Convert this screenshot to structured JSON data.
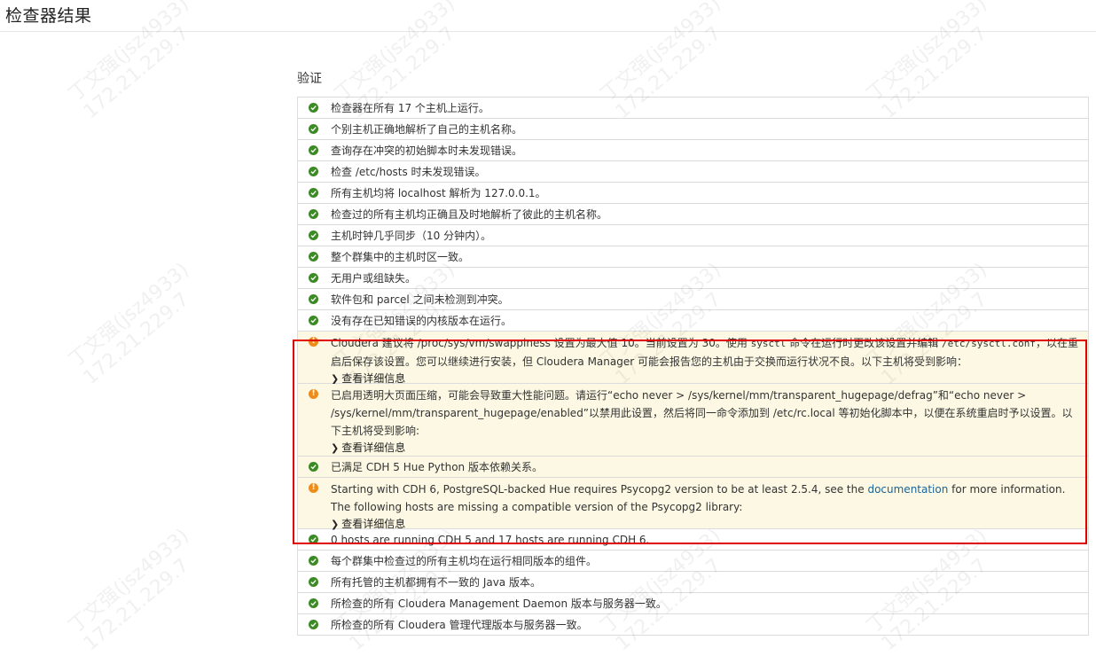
{
  "page": {
    "title": "检查器结果"
  },
  "section": {
    "title": "验证"
  },
  "details_label": "查看详细信息",
  "watermark": {
    "line1": "丁文强(jsz4933)",
    "line2": "172.21.229.7"
  },
  "rows": [
    {
      "status": "ok",
      "text": "检查器在所有 17 个主机上运行。"
    },
    {
      "status": "ok",
      "text": "个别主机正确地解析了自己的主机名称。"
    },
    {
      "status": "ok",
      "text": "查询存在冲突的初始脚本时未发现错误。"
    },
    {
      "status": "ok",
      "text": "检查 /etc/hosts 时未发现错误。"
    },
    {
      "status": "ok",
      "text": "所有主机均将 localhost 解析为 127.0.0.1。"
    },
    {
      "status": "ok",
      "text": "检查过的所有主机均正确且及时地解析了彼此的主机名称。"
    },
    {
      "status": "ok",
      "text": "主机时钟几乎同步（10 分钟内）。"
    },
    {
      "status": "ok",
      "text": "整个群集中的主机时区一致。"
    },
    {
      "status": "ok",
      "text": "无用户或组缺失。"
    },
    {
      "status": "ok",
      "text": "软件包和 parcel 之间未检测到冲突。"
    },
    {
      "status": "ok",
      "text": "没有存在已知错误的内核版本在运行。"
    },
    {
      "status": "warn",
      "text_a": "Cloudera 建议将 /proc/sys/vm/swappiness 设置为最大值 10。当前设置为 30。使用 ",
      "code_1": "sysctl",
      "text_b": " 命令在运行时更改该设置并编辑 ",
      "code_2": "/etc/sysctl.conf",
      "text_c": "，以在重启后保存该设置。您可以继续进行安装，但 Cloudera Manager 可能会报告您的主机由于交换而运行状况不良。以下主机将受到影响："
    },
    {
      "status": "warn",
      "text": "已启用透明大页面压缩，可能会导致重大性能问题。请运行“echo never > /sys/kernel/mm/transparent_hugepage/defrag”和“echo never > /sys/kernel/mm/transparent_hugepage/enabled”以禁用此设置，然后将同一命令添加到 /etc/rc.local 等初始化脚本中，以便在系统重启时予以设置。以下主机将受到影响:"
    },
    {
      "status": "ok",
      "text": "已满足 CDH 5 Hue Python 版本依赖关系。"
    },
    {
      "status": "warn",
      "text_a": "Starting with CDH 6, PostgreSQL-backed Hue requires Psycopg2 version to be at least 2.5.4, see the ",
      "link": "documentation",
      "text_b": " for more information. The following hosts are missing a compatible version of the Psycopg2 library:"
    },
    {
      "status": "ok",
      "text": "0 hosts are running CDH 5 and 17 hosts are running CDH 6."
    },
    {
      "status": "ok",
      "text": "每个群集中检查过的所有主机均在运行相同版本的组件。"
    },
    {
      "status": "ok",
      "text": "所有托管的主机都拥有不一致的 Java 版本。"
    },
    {
      "status": "ok",
      "text": "所检查的所有 Cloudera Management Daemon 版本与服务器一致。"
    },
    {
      "status": "ok",
      "text": "所检查的所有 Cloudera 管理代理版本与服务器一致。"
    }
  ],
  "colors": {
    "ok": "#3b8a24",
    "warn": "#ef8b1b",
    "warn_bg": "#fcf8e3",
    "highlight": "#e00000",
    "link": "#1a6496"
  }
}
